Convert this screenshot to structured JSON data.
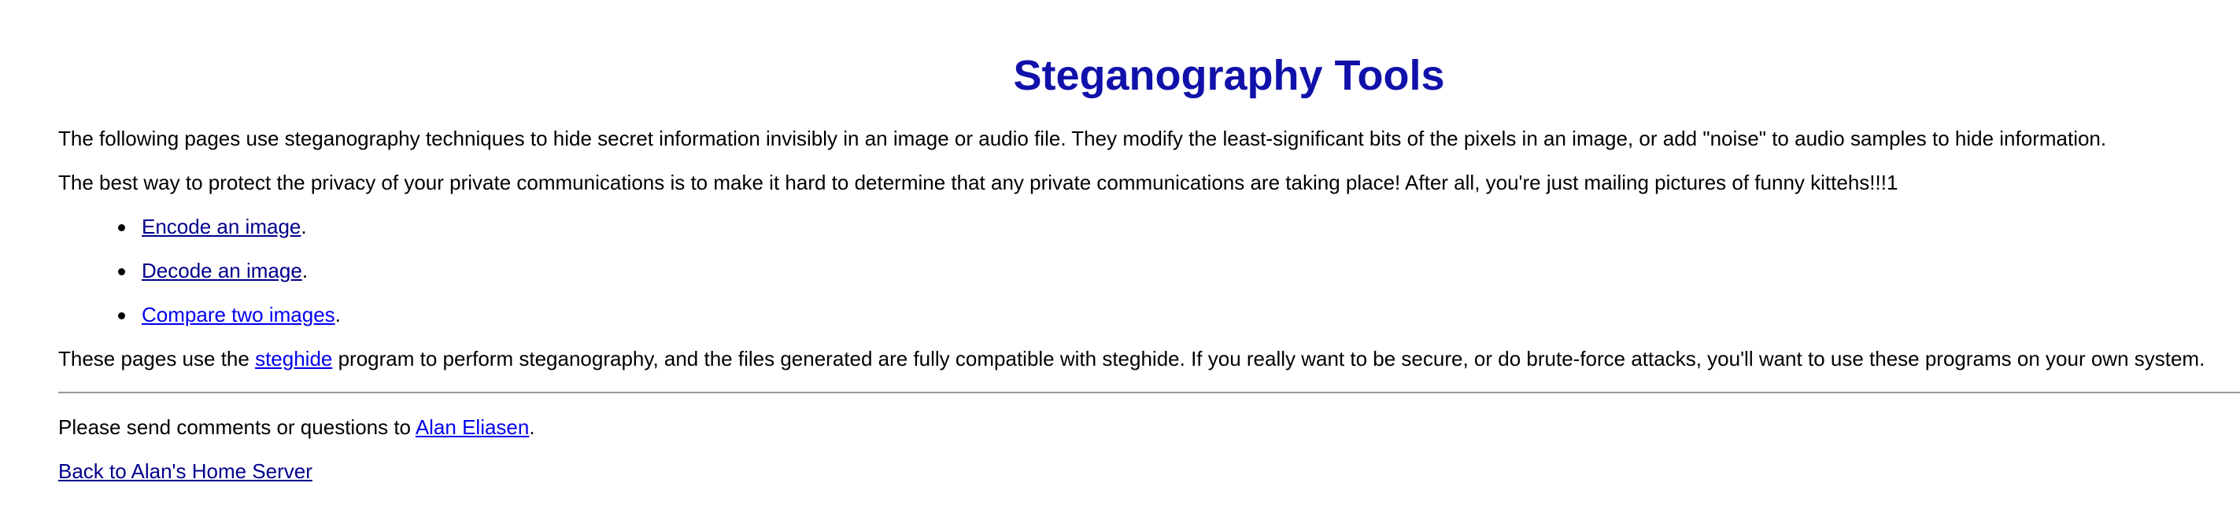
{
  "title": "Steganography Tools",
  "intro": "The following pages use steganography techniques to hide secret information invisibly in an image or audio file. They modify the least-significant bits of the pixels in an image, or add \"noise\" to audio samples to hide information.",
  "privacy": "The best way to protect the privacy of your private communications is to make it hard to determine that any private communications are taking place! After all, you're just mailing pictures of funny kittehs!!!1",
  "links": [
    {
      "label": "Encode an image",
      "suffix": "."
    },
    {
      "label": "Decode an image",
      "suffix": "."
    },
    {
      "label": "Compare two images",
      "suffix": "."
    }
  ],
  "steghide": {
    "before": "These pages use the ",
    "link": "steghide",
    "after": " program to perform steganography, and the files generated are fully compatible with steghide. If you really want to be secure, or do brute-force attacks, you'll want to use these programs on your own system."
  },
  "contact": {
    "before": "Please send comments or questions to ",
    "link": "Alan Eliasen",
    "after": "."
  },
  "back_link": "Back to Alan's Home Server",
  "colors": {
    "title": "#1111aa",
    "link": "#0000ee",
    "visited_link": "#00008b",
    "rule": "#9a9a9a"
  }
}
